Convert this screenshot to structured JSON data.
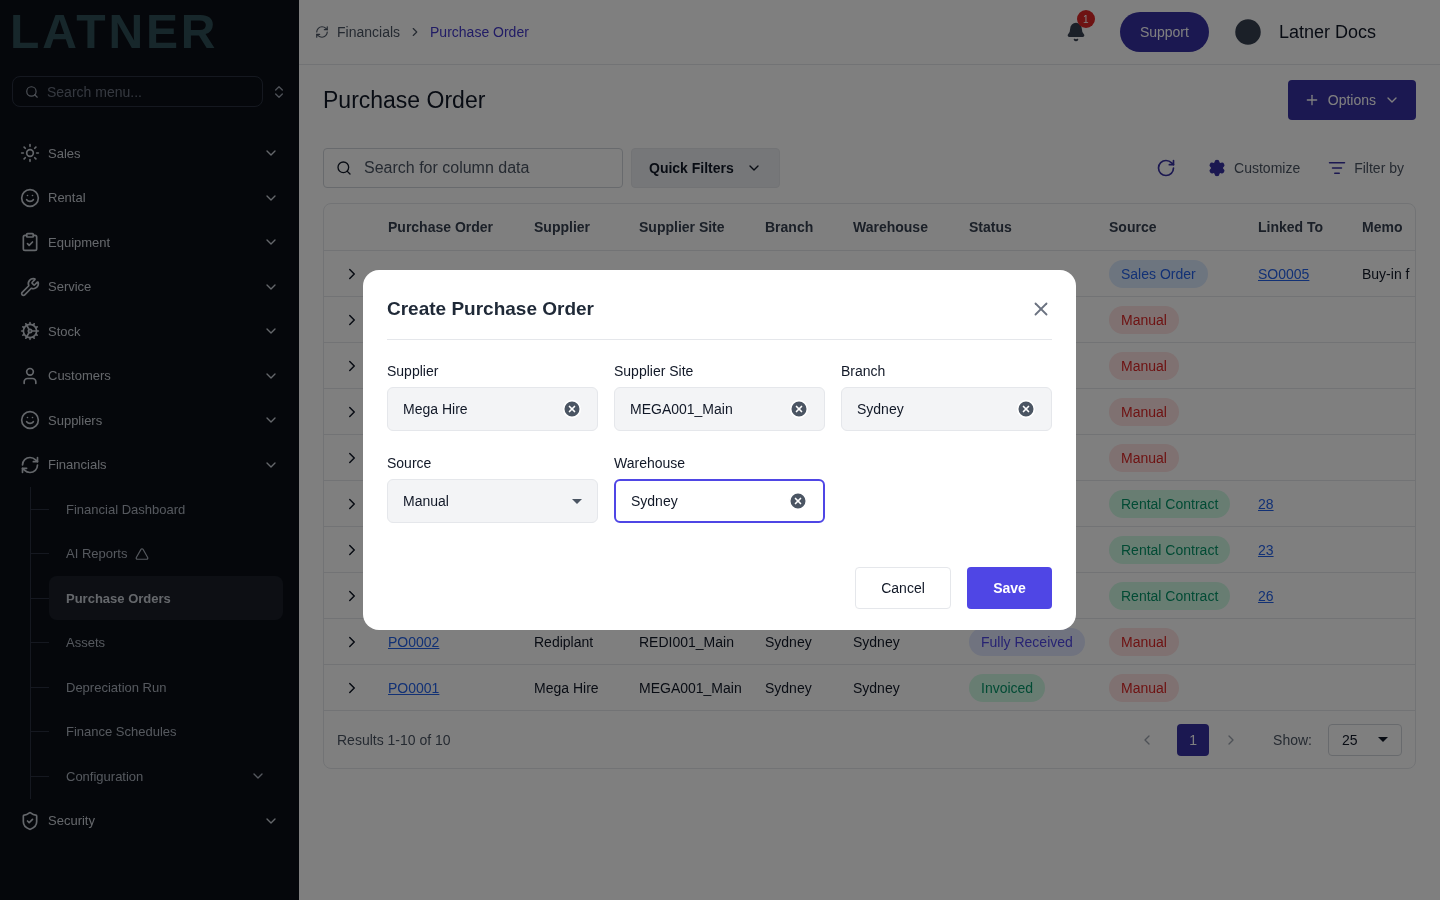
{
  "sidebar": {
    "logo": "LATNER",
    "search": {
      "placeholder": "Search menu..."
    },
    "items": [
      {
        "label": "Sales"
      },
      {
        "label": "Rental"
      },
      {
        "label": "Equipment"
      },
      {
        "label": "Service"
      },
      {
        "label": "Stock"
      },
      {
        "label": "Customers"
      },
      {
        "label": "Suppliers"
      },
      {
        "label": "Financials",
        "children": [
          {
            "label": "Financial Dashboard",
            "selected": false
          },
          {
            "label": "AI Reports",
            "selected": false,
            "ai": true
          },
          {
            "label": "Purchase Orders",
            "selected": true
          },
          {
            "label": "Assets",
            "selected": false
          },
          {
            "label": "Depreciation Run",
            "selected": false
          },
          {
            "label": "Finance Schedules",
            "selected": false
          },
          {
            "label": "Configuration",
            "selected": false,
            "has_children": true
          }
        ]
      },
      {
        "label": "Security"
      }
    ]
  },
  "topbar": {
    "breadcrumb": [
      "Financials",
      "Purchase Order"
    ],
    "notifications": "1",
    "support": "Support",
    "user": "Latner Docs"
  },
  "page": {
    "title": "Purchase Order",
    "options": "Options",
    "search": {
      "placeholder": "Search for column data"
    },
    "quick_filters": "Quick Filters",
    "customize": "Customize",
    "filter_by": "Filter by"
  },
  "table": {
    "columns": [
      "Purchase Order",
      "Supplier",
      "Supplier Site",
      "Branch",
      "Warehouse",
      "Status",
      "Source",
      "Linked To",
      "Memo"
    ],
    "rows": [
      {
        "source": {
          "text": "Sales Order",
          "kind": "info"
        },
        "linked_to": "SO0005",
        "memo": "Buy-in f"
      },
      {
        "source": {
          "text": "Manual",
          "kind": "danger"
        }
      },
      {
        "source": {
          "text": "Manual",
          "kind": "danger"
        }
      },
      {
        "source": {
          "text": "Manual",
          "kind": "danger"
        }
      },
      {
        "source": {
          "text": "Manual",
          "kind": "danger"
        }
      },
      {
        "source": {
          "text": "Rental Contract",
          "kind": "success"
        },
        "linked_to": "28"
      },
      {
        "source": {
          "text": "Rental Contract",
          "kind": "success"
        },
        "linked_to": "23"
      },
      {
        "source": {
          "text": "Rental Contract",
          "kind": "success"
        },
        "linked_to": "26"
      },
      {
        "po": "PO0002",
        "supplier": "Rediplant",
        "site": "REDI001_Main",
        "branch": "Sydney",
        "warehouse": "Sydney",
        "status": {
          "text": "Fully Received",
          "kind": "accent"
        },
        "source": {
          "text": "Manual",
          "kind": "danger"
        }
      },
      {
        "po": "PO0001",
        "supplier": "Mega Hire",
        "site": "MEGA001_Main",
        "branch": "Sydney",
        "warehouse": "Sydney",
        "status": {
          "text": "Invoiced",
          "kind": "success"
        },
        "source": {
          "text": "Manual",
          "kind": "danger"
        }
      }
    ],
    "results": "Results 1-10 of 10",
    "page": "1",
    "show_label": "Show:",
    "show_value": "25"
  },
  "modal": {
    "title": "Create Purchase Order",
    "fields": [
      {
        "label": "Supplier",
        "value": "Mega Hire",
        "kind": "clearable",
        "focused": false
      },
      {
        "label": "Supplier Site",
        "value": "MEGA001_Main",
        "kind": "clearable",
        "focused": false
      },
      {
        "label": "Branch",
        "value": "Sydney",
        "kind": "clearable",
        "focused": false
      },
      {
        "label": "Source",
        "value": "Manual",
        "kind": "select",
        "focused": false
      },
      {
        "label": "Warehouse",
        "value": "Sydney",
        "kind": "clearable",
        "focused": true
      }
    ],
    "cancel": "Cancel",
    "save": "Save"
  }
}
